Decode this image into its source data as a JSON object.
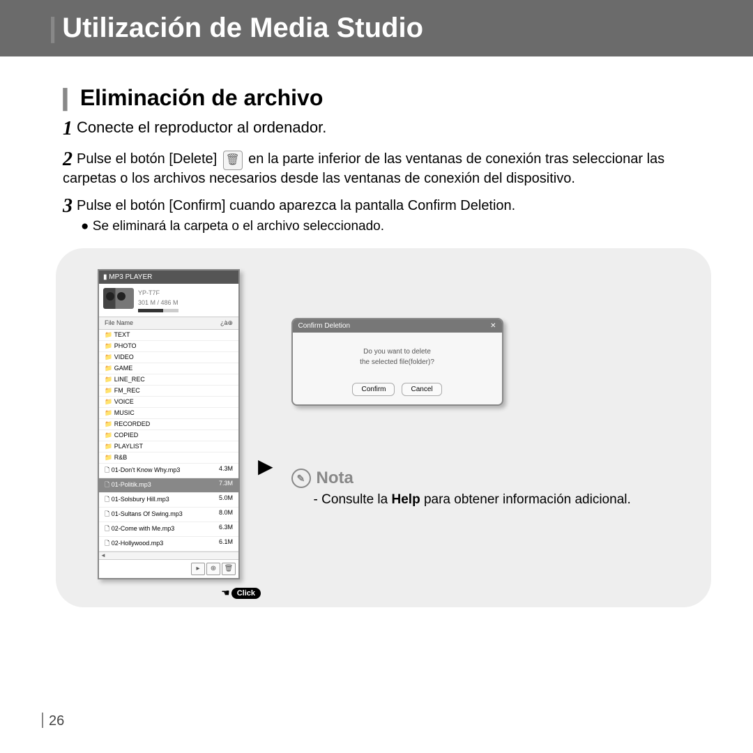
{
  "header": {
    "title": "Utilización de Media Studio"
  },
  "sub": "Eliminación de archivo",
  "steps": {
    "s1": "Conecte el reproductor al ordenador.",
    "s2a": "Pulse el botón [Delete]",
    "s2b": "en la parte inferior de las ventanas de conexión tras seleccionar las carpetas o los archivos necesarios desde las ventanas de conexión del dispositivo.",
    "s3": "Pulse el botón [Confirm] cuando aparezca la pantalla Confirm Deletion.",
    "s3b": "Se eliminará la carpeta o el archivo seleccionado."
  },
  "player": {
    "title": "▮ MP3 PLAYER",
    "dev": "YP-T7F",
    "space": "301 M / 486 M",
    "col1": "File Name",
    "col2": "¿à⊕",
    "folders": [
      "TEXT",
      "PHOTO",
      "VIDEO",
      "GAME",
      "LINE_REC",
      "FM_REC",
      "VOICE",
      "MUSIC",
      "RECORDED",
      "COPIED",
      "PLAYLIST",
      "R&B"
    ],
    "files": [
      {
        "n": "01-Don't Know Why.mp3",
        "s": "4.3M"
      },
      {
        "n": "01-Politik.mp3",
        "s": "7.3M",
        "sel": true
      },
      {
        "n": "01-Solsbury Hill.mp3",
        "s": "5.0M"
      },
      {
        "n": "01-Sultans Of Swing.mp3",
        "s": "8.0M"
      },
      {
        "n": "02-Come with Me.mp3",
        "s": "6.3M"
      },
      {
        "n": "02-Hollywood.mp3",
        "s": "6.1M"
      }
    ],
    "click": "Click"
  },
  "dialog": {
    "title": "Confirm Deletion",
    "l1": "Do you want to delete",
    "l2": "the selected file(folder)?",
    "confirm": "Confirm",
    "cancel": "Cancel"
  },
  "note": {
    "label": "Nota",
    "text_a": "- Consulte la ",
    "bold": "Help",
    "text_b": " para obtener información adicional."
  },
  "page": "26"
}
